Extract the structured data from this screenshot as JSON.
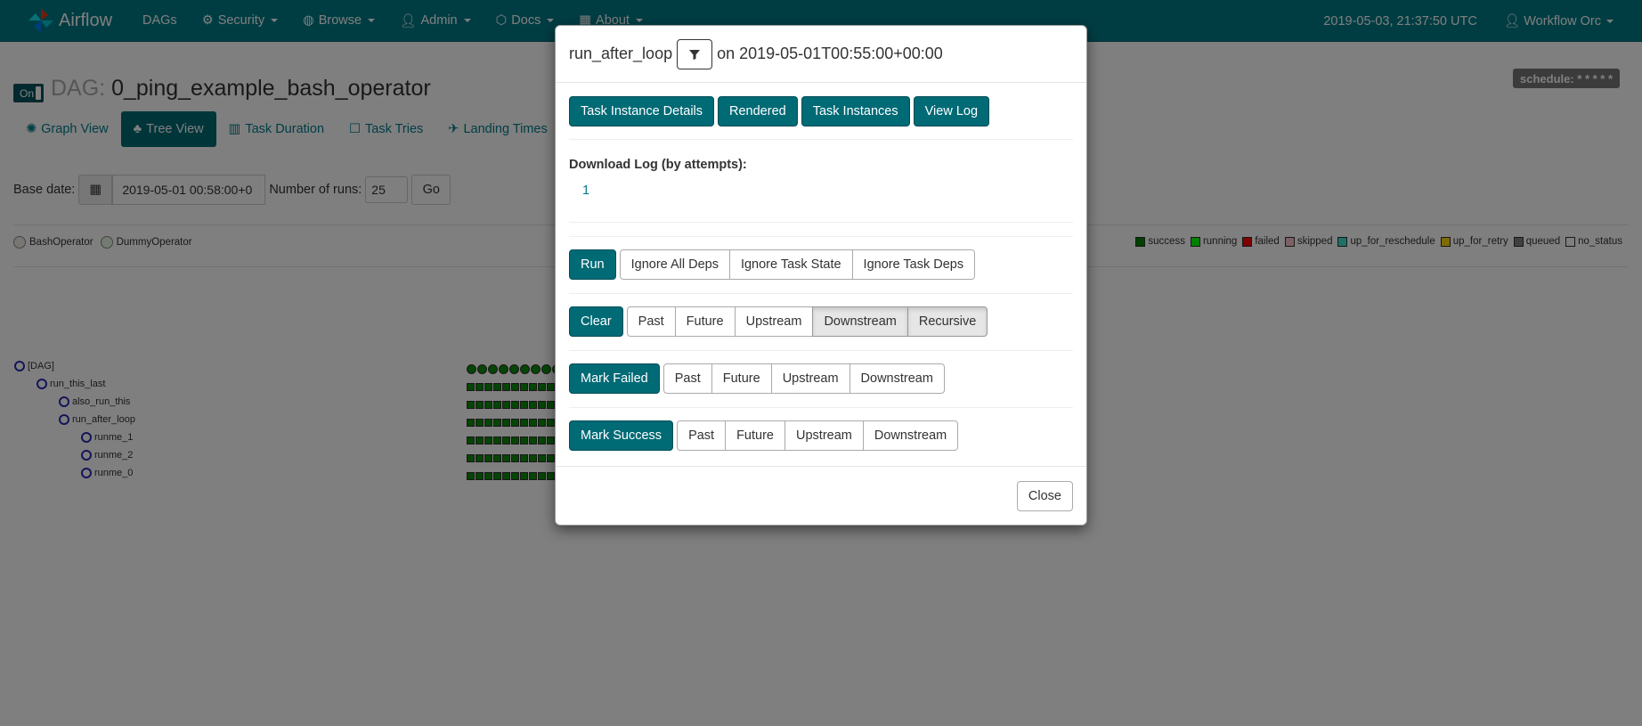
{
  "navbar": {
    "brand": "Airflow",
    "items": [
      {
        "label": "DAGs",
        "caret": false
      },
      {
        "label": "Security",
        "caret": true
      },
      {
        "label": "Browse",
        "caret": true
      },
      {
        "label": "Admin",
        "caret": true
      },
      {
        "label": "Docs",
        "caret": true
      },
      {
        "label": "About",
        "caret": true
      }
    ],
    "time": "2019-05-03, 21:37:50 UTC",
    "user": "Workflow Orc"
  },
  "dag": {
    "toggle": "On",
    "label": "DAG:",
    "name": "0_ping_example_bash_operator",
    "schedule": "schedule: * * * * *"
  },
  "view_tabs": [
    "Graph View",
    "Tree View",
    "Task Duration",
    "Task Tries",
    "Landing Times"
  ],
  "base": {
    "label": "Base date:",
    "value": "2019-05-01 00:58:00+0",
    "runs_label": "Number of runs:",
    "runs_value": "25",
    "go": "Go"
  },
  "operators": [
    "BashOperator",
    "DummyOperator"
  ],
  "legend": [
    {
      "label": "success",
      "color": "#008000"
    },
    {
      "label": "running",
      "color": "#00ff00"
    },
    {
      "label": "failed",
      "color": "#ff0000"
    },
    {
      "label": "skipped",
      "color": "#ffc0cb"
    },
    {
      "label": "up_for_reschedule",
      "color": "#40e0d0"
    },
    {
      "label": "up_for_retry",
      "color": "#ffd700"
    },
    {
      "label": "queued",
      "color": "#808080"
    },
    {
      "label": "no_status",
      "color": "#ffffff"
    }
  ],
  "tree": [
    "[DAG]",
    "run_this_last",
    "also_run_this",
    "run_after_loop",
    "runme_1",
    "runme_2",
    "runme_0"
  ],
  "modal": {
    "task": "run_after_loop",
    "on_text": "on 2019-05-01T00:55:00+00:00",
    "top_buttons": [
      "Task Instance Details",
      "Rendered",
      "Task Instances",
      "View Log"
    ],
    "download_title": "Download Log (by attempts):",
    "download_attempt": "1",
    "run": {
      "label": "Run",
      "options": [
        "Ignore All Deps",
        "Ignore Task State",
        "Ignore Task Deps"
      ]
    },
    "clear": {
      "label": "Clear",
      "options": [
        "Past",
        "Future",
        "Upstream",
        "Downstream",
        "Recursive"
      ]
    },
    "mark_failed": {
      "label": "Mark Failed",
      "options": [
        "Past",
        "Future",
        "Upstream",
        "Downstream"
      ]
    },
    "mark_success": {
      "label": "Mark Success",
      "options": [
        "Past",
        "Future",
        "Upstream",
        "Downstream"
      ]
    },
    "close": "Close"
  }
}
